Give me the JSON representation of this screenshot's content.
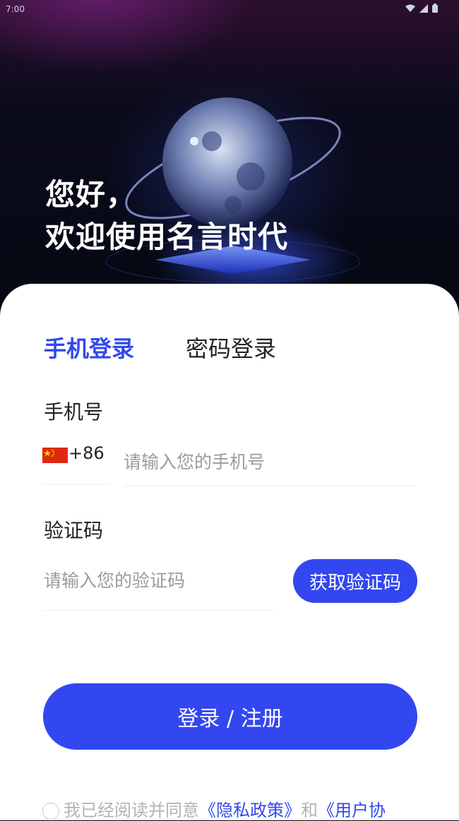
{
  "status_bar": {
    "time": "7:00"
  },
  "hero": {
    "greeting_line1": "您好，",
    "greeting_line2": "欢迎使用名言时代"
  },
  "tabs": {
    "phone_login": "手机登录",
    "password_login": "密码登录"
  },
  "phone": {
    "label": "手机号",
    "country_code": "+86",
    "placeholder": "请输入您的手机号"
  },
  "code": {
    "label": "验证码",
    "placeholder": "请输入您的验证码",
    "button": "获取验证码"
  },
  "submit": {
    "label": "登录 / 注册"
  },
  "agreement": {
    "prefix": "我已经阅读并同意",
    "privacy_link": "《隐私政策》",
    "and": "和",
    "user_link": "《用户协"
  },
  "colors": {
    "accent": "#3347f0",
    "text": "#222222",
    "placeholder": "#9b9b9b"
  },
  "icons": {
    "flag": "china-flag-icon",
    "wifi": "wifi-icon",
    "signal": "signal-icon",
    "battery": "battery-icon"
  }
}
